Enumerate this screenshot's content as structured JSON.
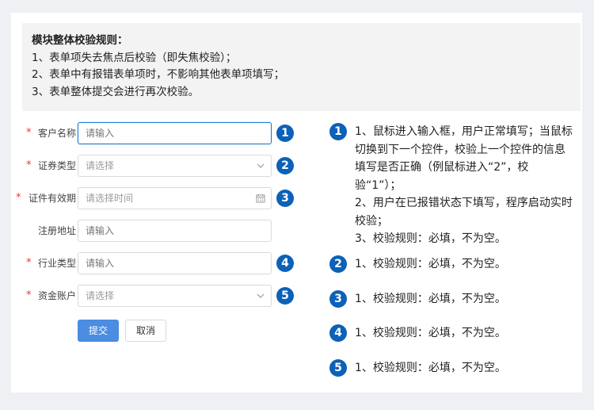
{
  "rules": {
    "title": "模块整体校验规则：",
    "lines": [
      "1、表单项失去焦点后校验（即失焦校验）；",
      "2、表单中有报错表单项时，不影响其他表单项填写；",
      "3、表单整体提交会进行再次校验。"
    ]
  },
  "form": {
    "fields": [
      {
        "label": "客户名称",
        "required": "*",
        "placeholder": "请输入",
        "badge": "1"
      },
      {
        "label": "证券类型",
        "required": "*",
        "placeholder": "请选择",
        "badge": "2"
      },
      {
        "label": "证件有效期",
        "required": "*",
        "placeholder": "请选择时间",
        "badge": "3"
      },
      {
        "label": "注册地址",
        "placeholder": "请输入"
      },
      {
        "label": "行业类型",
        "required": "*",
        "placeholder": "请输入",
        "badge": "4"
      },
      {
        "label": "资金账户",
        "required": "*",
        "placeholder": "请选择",
        "badge": "5"
      }
    ],
    "submit_label": "提交",
    "cancel_label": "取消"
  },
  "notes": [
    {
      "badge": "1",
      "lines": [
        "1、鼠标进入输入框，用户正常填写；当鼠标切换到下一个控件，校验上一个控件的信息填写是否正确（例鼠标进入“2”，校验“1”）；",
        "2、用户在已报错状态下填写，程序启动实时校验；",
        "3、校验规则：必填，不为空。"
      ]
    },
    {
      "badge": "2",
      "lines": [
        "1、校验规则：必填，不为空。"
      ]
    },
    {
      "badge": "3",
      "lines": [
        "1、校验规则：必填，不为空。"
      ]
    },
    {
      "badge": "4",
      "lines": [
        "1、校验规则：必填，不为空。"
      ]
    },
    {
      "badge": "5",
      "lines": [
        "1、校验规则：必填，不为空。"
      ]
    }
  ],
  "icons": {
    "select": "chevron-down-icon",
    "date": "calendar-icon"
  },
  "colors": {
    "primary": "#4a8de2",
    "badge": "#0c61b8",
    "required": "#e53935",
    "focus": "#1677d2"
  }
}
